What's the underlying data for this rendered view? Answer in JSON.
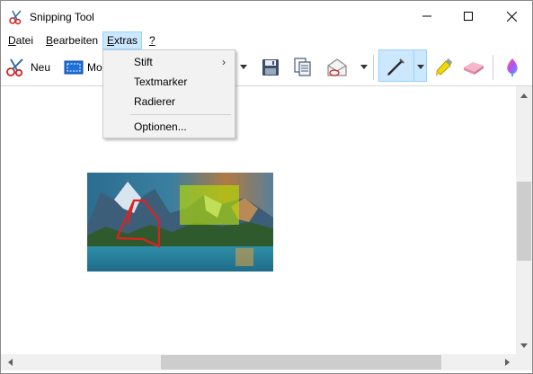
{
  "window": {
    "title": "Snipping Tool"
  },
  "menubar": {
    "items": [
      {
        "label": "Datei",
        "mnemonic": "D",
        "rest": "atei"
      },
      {
        "label": "Bearbeiten",
        "mnemonic": "B",
        "rest": "earbeiten"
      },
      {
        "label": "Extras",
        "mnemonic": "E",
        "rest": "xtras",
        "active": true
      },
      {
        "label": "?",
        "mnemonic": "?",
        "rest": ""
      }
    ]
  },
  "toolbar": {
    "new_label": "Neu",
    "mode_label_visible": "Mo"
  },
  "extras_menu": {
    "items": [
      {
        "label": "Stift",
        "submenu": true
      },
      {
        "label": "Textmarker"
      },
      {
        "label": "Radierer"
      },
      {
        "label": "Optionen..."
      }
    ]
  },
  "colors": {
    "menu_active_bg": "#cce8ff",
    "pen_active_bg": "#cce8ff",
    "annotation_red": "#e02020",
    "highlighter_yellow": "#c8e000"
  },
  "icons": {
    "app": "scissors-icon",
    "new": "scissors-icon",
    "mode": "rectangle-snip-icon",
    "save": "floppy-disk-icon",
    "copy": "copy-icon",
    "send": "envelope-icon",
    "pen": "pen-icon",
    "highlighter": "highlighter-icon",
    "eraser": "eraser-icon",
    "paint3d": "paint3d-icon"
  }
}
